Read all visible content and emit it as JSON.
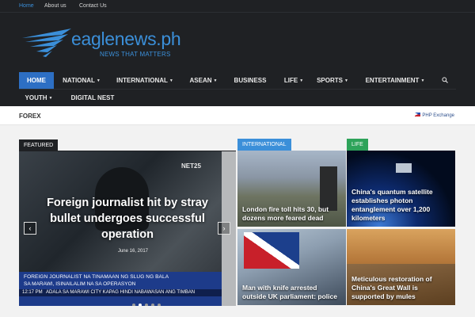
{
  "topbar": {
    "links": [
      "Home",
      "About us",
      "Contact Us"
    ]
  },
  "logo": {
    "title": "eaglenews.ph",
    "tagline": "NEWS THAT MATTERS"
  },
  "nav": {
    "items": [
      "HOME",
      "NATIONAL",
      "INTERNATIONAL",
      "ASEAN",
      "BUSINESS",
      "LIFE",
      "SPORTS",
      "ENTERTAINMENT",
      "YOUTH",
      "DIGITAL NEST"
    ]
  },
  "forex": {
    "label": "FOREX",
    "ticker": "PHP Exchange"
  },
  "featured": {
    "tag": "FEATURED",
    "title": "Foreign journalist hit by stray bullet undergoes successful operation",
    "date": "June 16, 2017",
    "overlay": {
      "logo": "NET25",
      "line1": "FOREIGN JOURNALIST NA TINAMAAN NG SLUG NG BALA",
      "line2": "SA MARAWI, ISINAILALIM NA SA OPERASYON",
      "time": "12:17 PM",
      "ticker": "ADALA SA MARAWI CITY KAPAG HINDI NABAWASAN ANG TIMBAN"
    },
    "slides": 5,
    "active_slide": 2
  },
  "sections": {
    "international": "INTERNATIONAL",
    "life": "LIFE"
  },
  "tiles": [
    {
      "title": "London fire toll hits 30, but dozens more feared dead"
    },
    {
      "title": "China's quantum satellite establishes photon entanglement over 1,200 kilometers"
    },
    {
      "title": "Man with knife arrested outside UK parliament: police"
    },
    {
      "title": "Meticulous restoration of China's Great Wall is supported by mules"
    }
  ],
  "colors": {
    "accent": "#3b8fd9",
    "dark": "#1f2124",
    "home_bg": "#2d6fc4",
    "life": "#2ea35a"
  }
}
